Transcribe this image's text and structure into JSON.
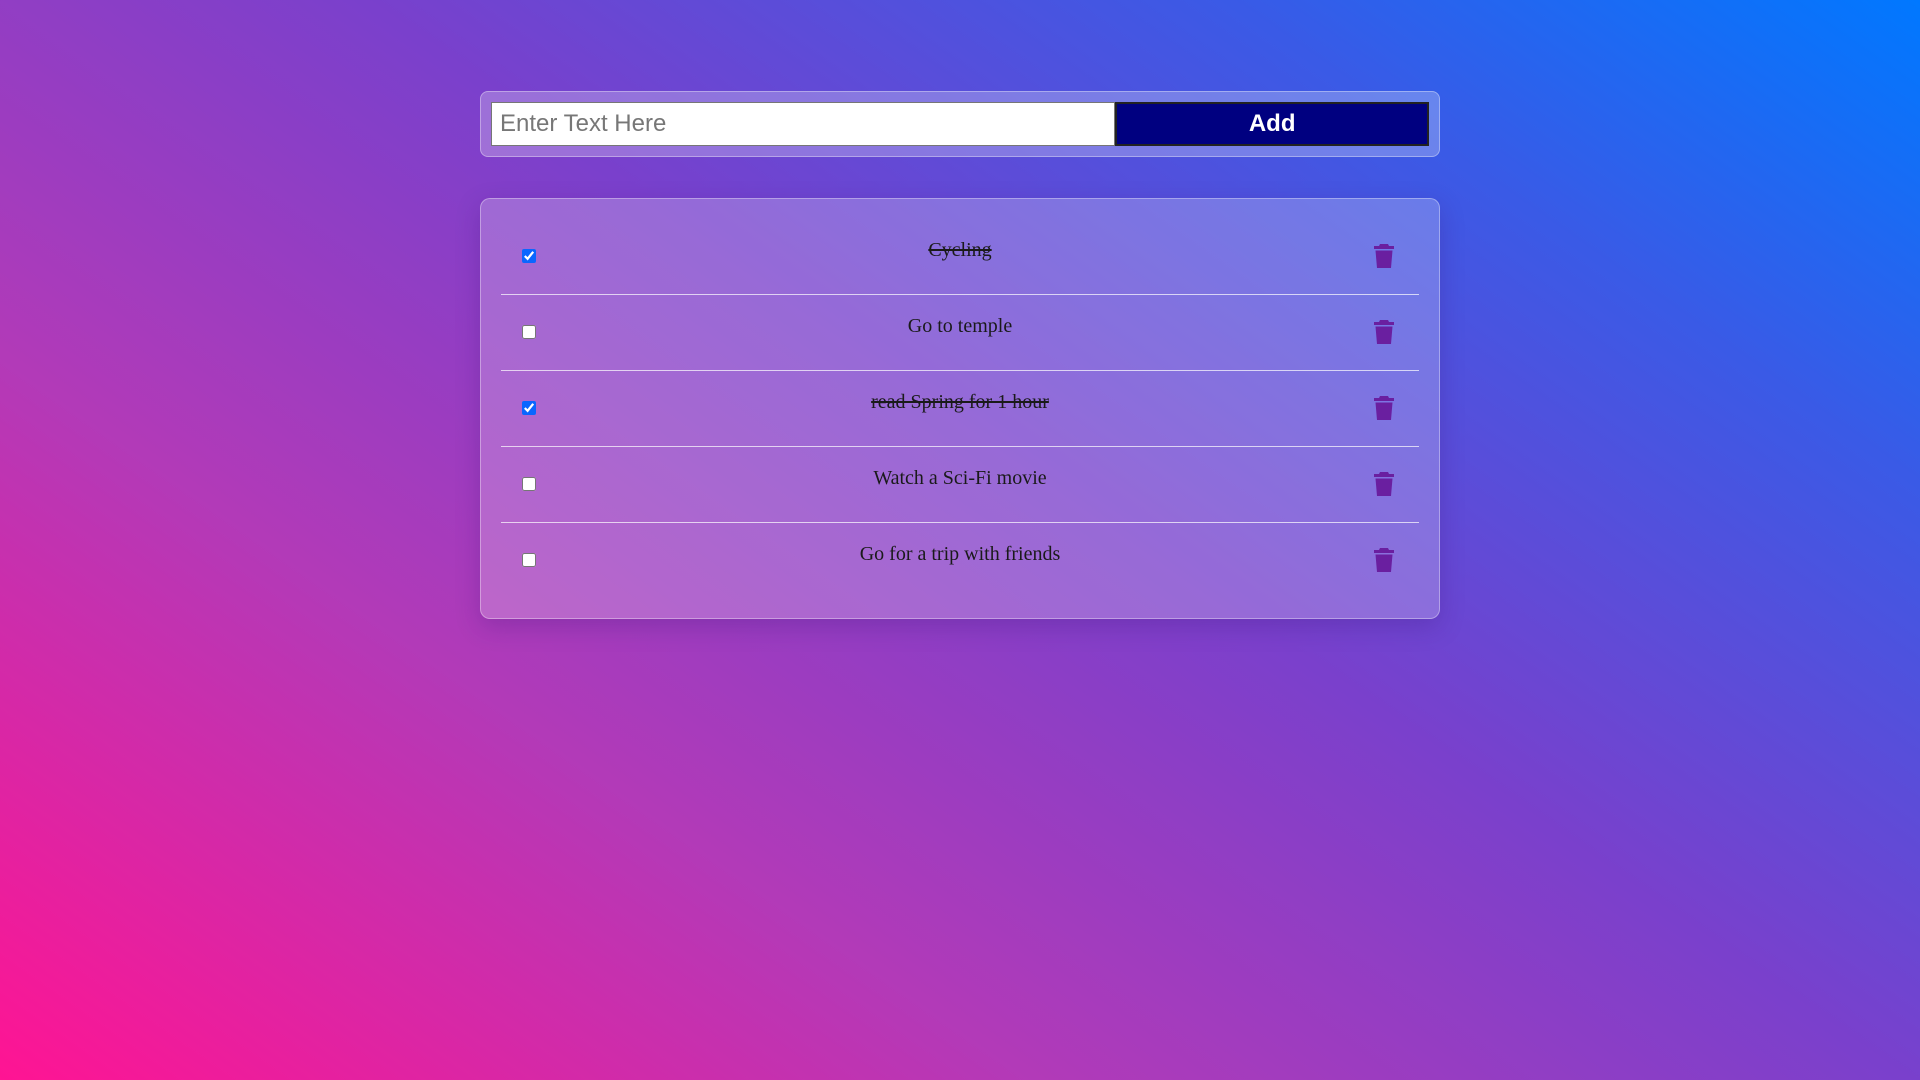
{
  "input": {
    "placeholder": "Enter Text Here",
    "value": ""
  },
  "add_button": {
    "label": "Add",
    "bg_color": "#000080"
  },
  "tasks": [
    {
      "text": "Cycling",
      "done": true
    },
    {
      "text": "Go to temple",
      "done": false
    },
    {
      "text": "read Spring for 1 hour",
      "done": true
    },
    {
      "text": "Watch a Sci-Fi movie",
      "done": false
    },
    {
      "text": "Go for a trip with friends",
      "done": false
    }
  ],
  "icons": {
    "delete": "trash-icon"
  },
  "colors": {
    "trash_icon": "#6a1fa0",
    "gradient_start": "#ff1493",
    "gradient_end": "#0078ff"
  }
}
